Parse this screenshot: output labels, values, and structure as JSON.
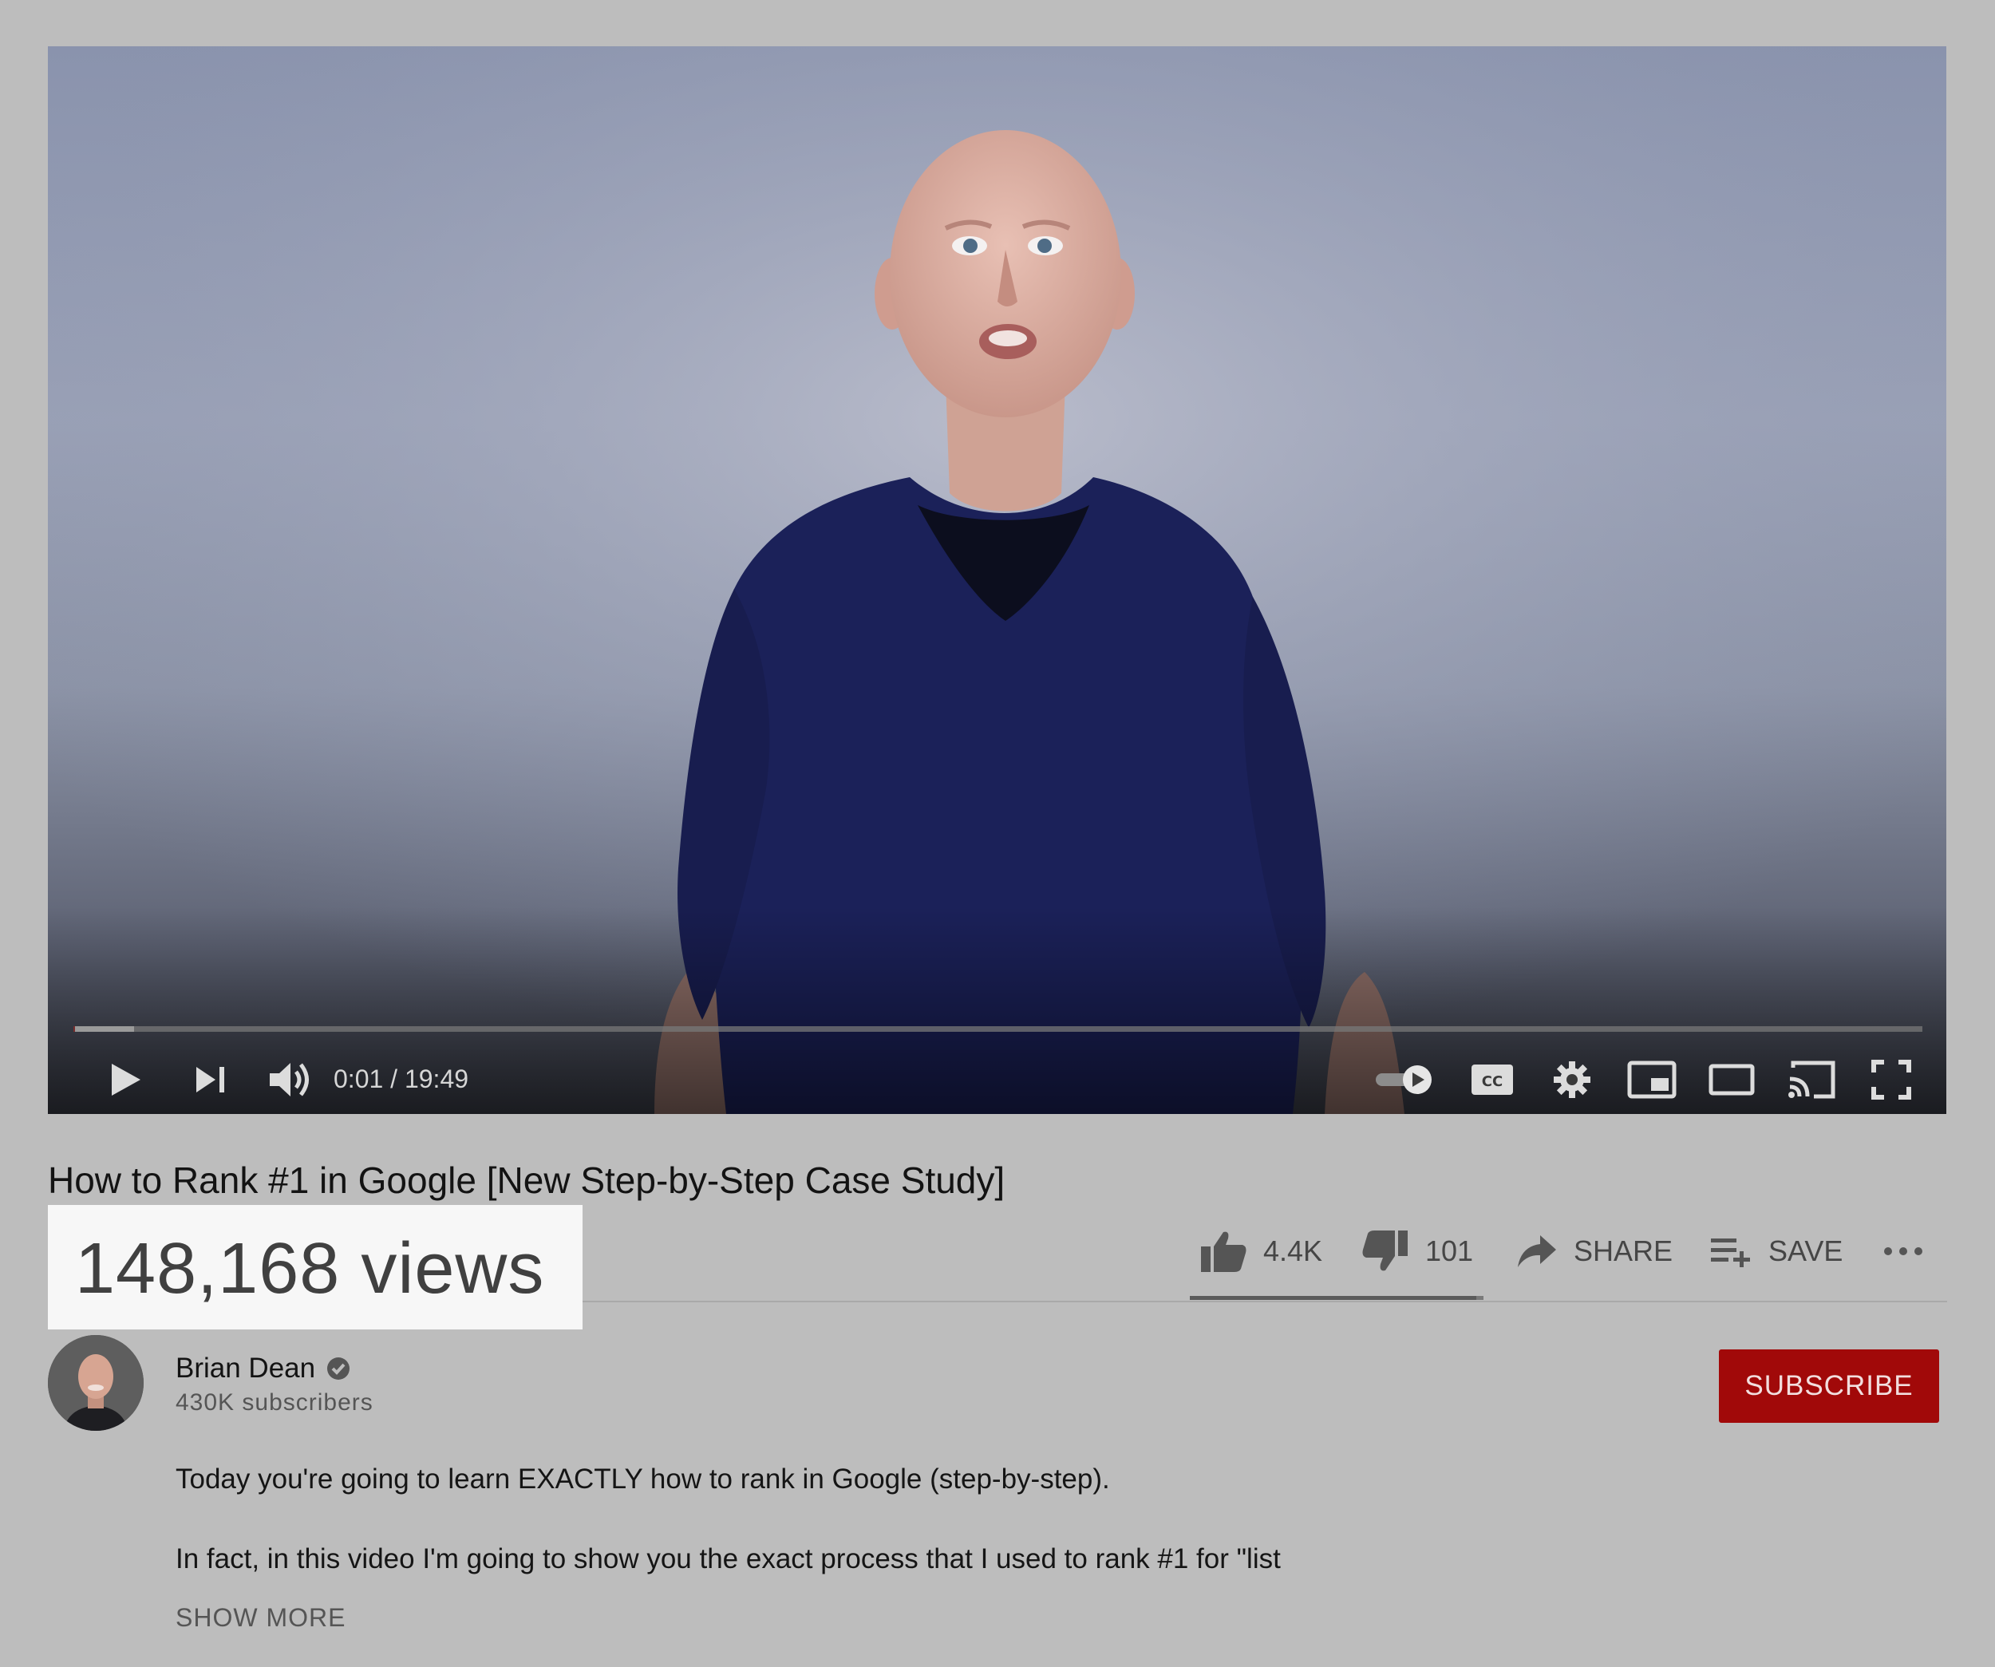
{
  "player": {
    "time_display": "0:01 / 19:49",
    "progress_fraction": 0.0009,
    "buffered_fraction": 0.033
  },
  "video": {
    "title": "How to Rank #1 in Google [New Step-by-Step Case Study]",
    "views": "148,168 views"
  },
  "actions": {
    "likes": "4.4K",
    "dislikes": "101",
    "share_label": "SHARE",
    "save_label": "SAVE"
  },
  "sentiment": {
    "like_fraction": 0.976
  },
  "channel": {
    "name": "Brian Dean",
    "subscribers": "430K subscribers",
    "subscribe_label": "SUBSCRIBE"
  },
  "description": {
    "line1": "Today you're going to learn EXACTLY how to rank in Google (step-by-step).",
    "line2": "In fact, in this video I'm going to show you the exact process that I used to rank #1 for \"list",
    "show_more_label": "SHOW MORE"
  },
  "colors": {
    "subscribe_bg": "#a10909",
    "page_bg": "#bdbdbd",
    "highlight_bg": "#f7f7f7"
  }
}
